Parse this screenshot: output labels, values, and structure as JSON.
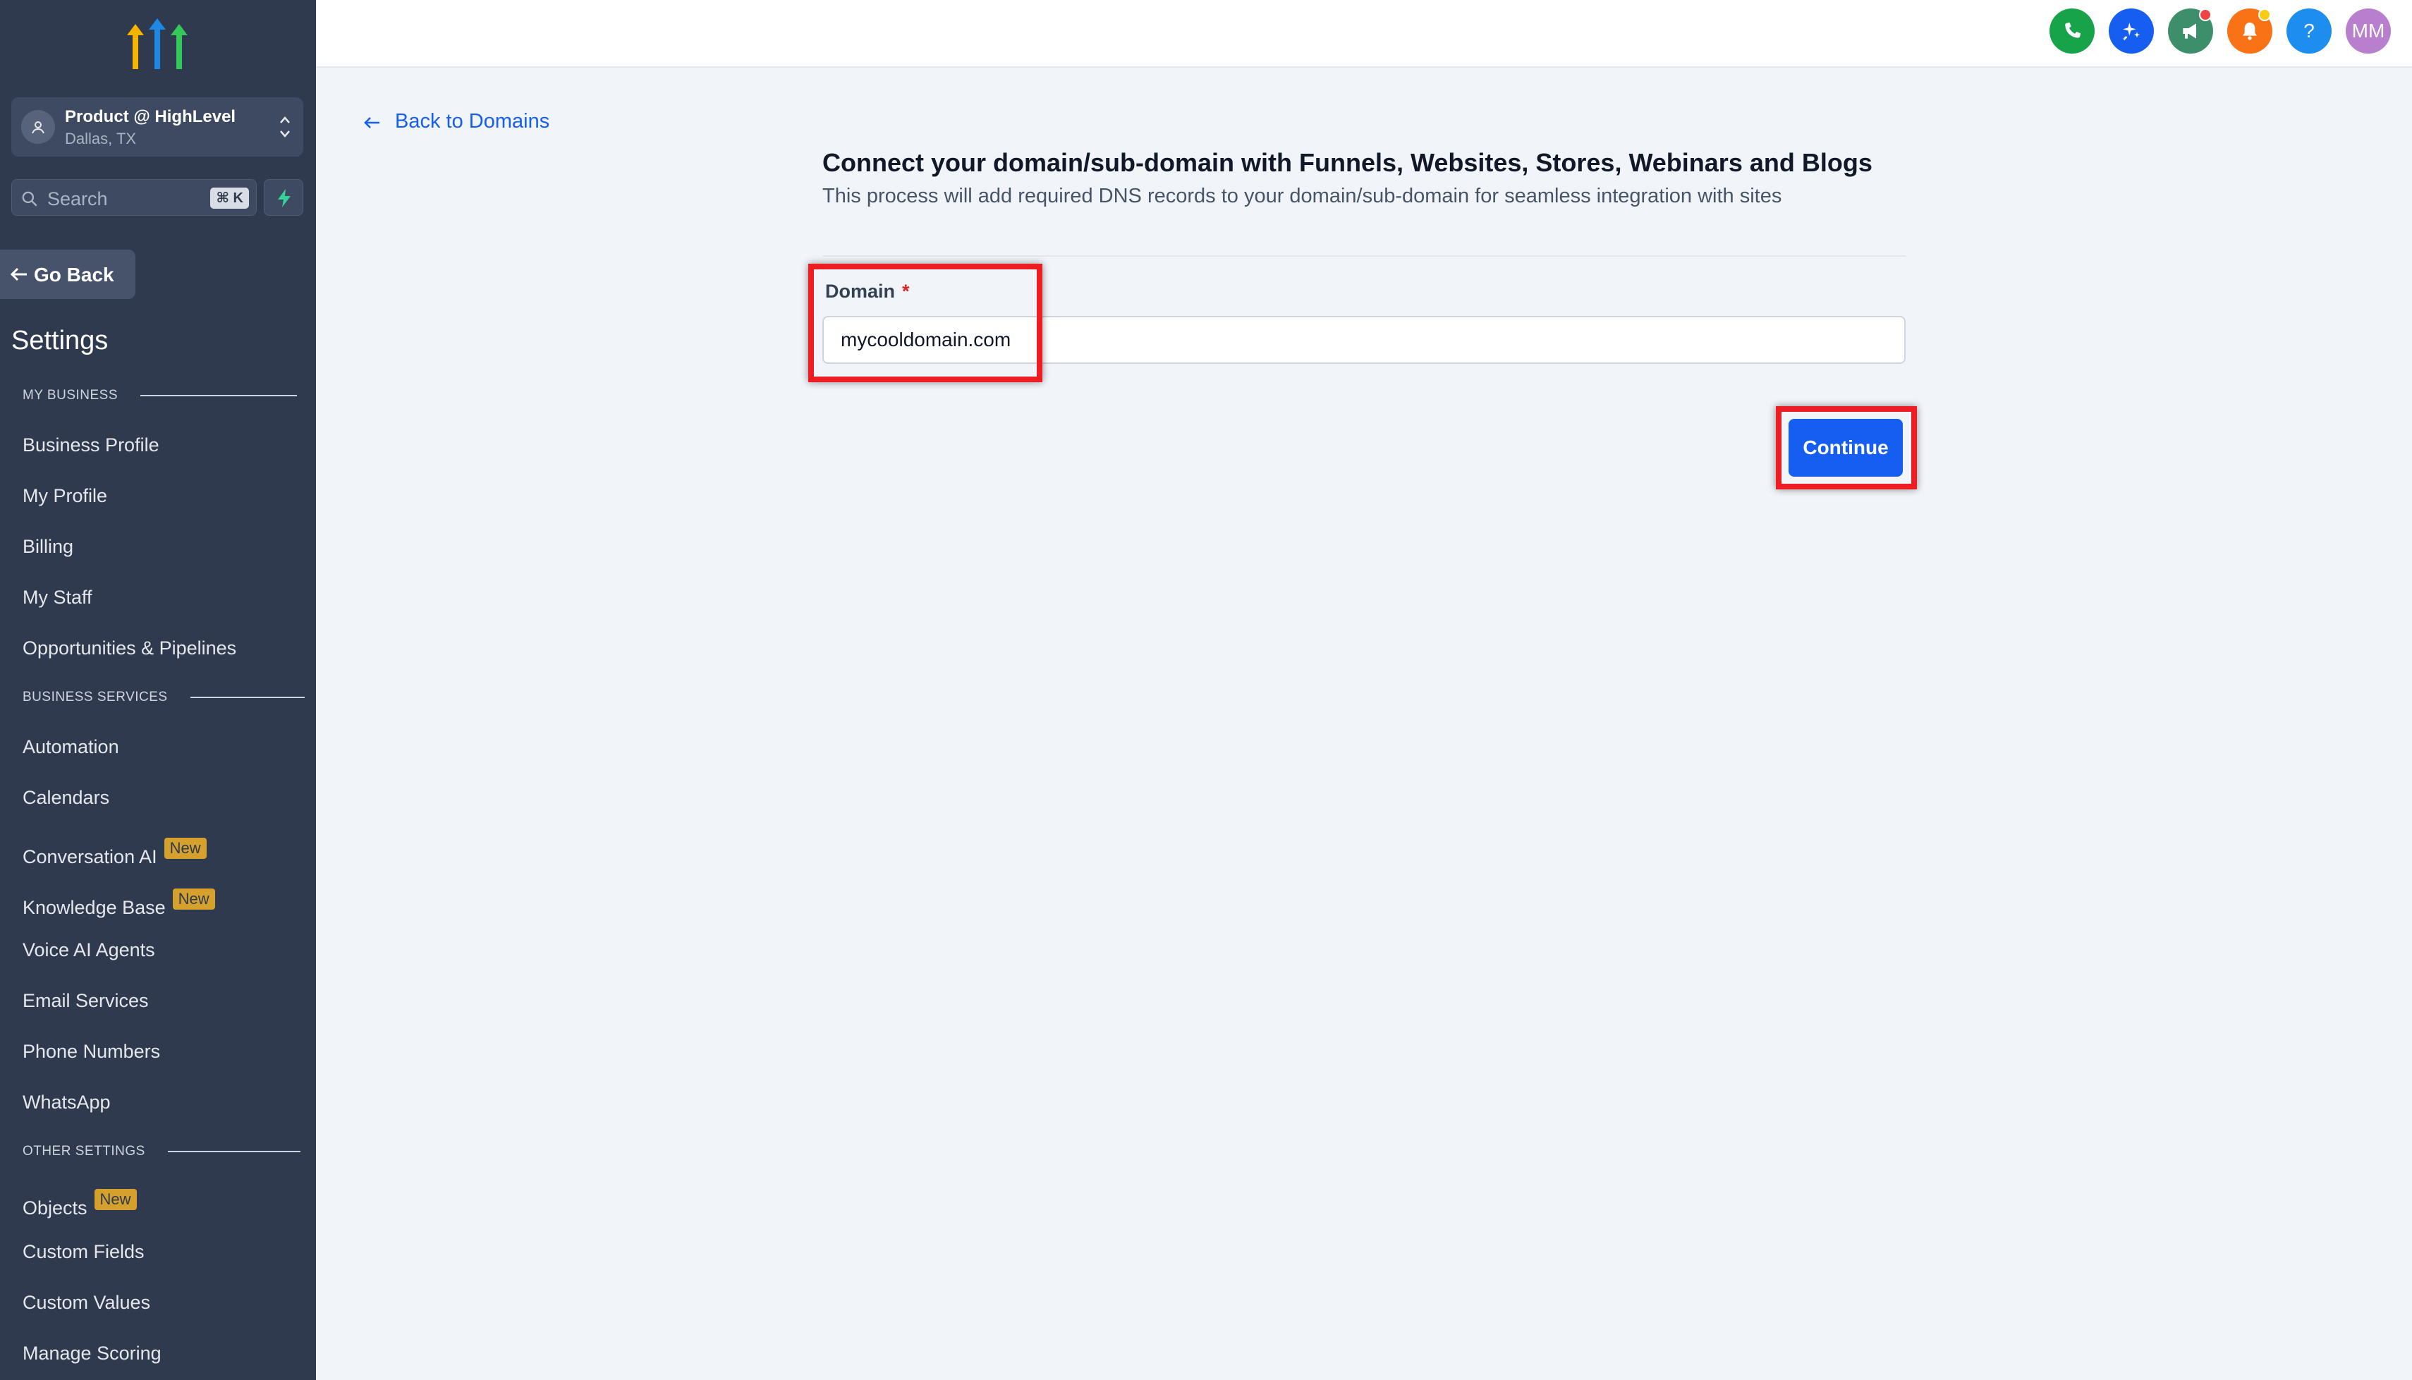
{
  "colors": {
    "sidebar_bg": "#2f3a4f",
    "primary": "#155eef",
    "badge": "#d6a02c",
    "highlight": "#ee1d23",
    "required": "#dc2626"
  },
  "sidebar": {
    "account": {
      "name": "Product @ HighLevel",
      "location": "Dallas, TX"
    },
    "search": {
      "placeholder": "Search",
      "shortcut": "⌘ K"
    },
    "go_back": "Go Back",
    "title": "Settings",
    "sections": [
      {
        "label": "MY BUSINESS",
        "items": [
          {
            "label": "Business Profile"
          },
          {
            "label": "My Profile"
          },
          {
            "label": "Billing"
          },
          {
            "label": "My Staff"
          },
          {
            "label": "Opportunities & Pipelines"
          }
        ]
      },
      {
        "label": "BUSINESS SERVICES",
        "items": [
          {
            "label": "Automation"
          },
          {
            "label": "Calendars"
          },
          {
            "label": "Conversation AI",
            "badge": "New"
          },
          {
            "label": "Knowledge Base",
            "badge": "New"
          },
          {
            "label": "Voice AI Agents"
          },
          {
            "label": "Email Services"
          },
          {
            "label": "Phone Numbers"
          },
          {
            "label": "WhatsApp"
          }
        ]
      },
      {
        "label": "OTHER SETTINGS",
        "items": [
          {
            "label": "Objects",
            "badge": "New"
          },
          {
            "label": "Custom Fields"
          },
          {
            "label": "Custom Values"
          },
          {
            "label": "Manage Scoring"
          }
        ]
      }
    ]
  },
  "topbar": {
    "icons": [
      "phone-icon",
      "sparkle-icon",
      "megaphone-icon",
      "bell-icon",
      "help-icon"
    ],
    "help_label": "?",
    "avatar_initials": "MM"
  },
  "main": {
    "back_link": "Back to Domains",
    "title": "Connect your domain/sub-domain with Funnels, Websites, Stores, Webinars and Blogs",
    "subtitle": "This process will add required DNS records to your domain/sub-domain for seamless integration with sites",
    "domain_label": "Domain",
    "required_mark": "*",
    "domain_value": "mycooldomain.com",
    "continue_label": "Continue"
  }
}
